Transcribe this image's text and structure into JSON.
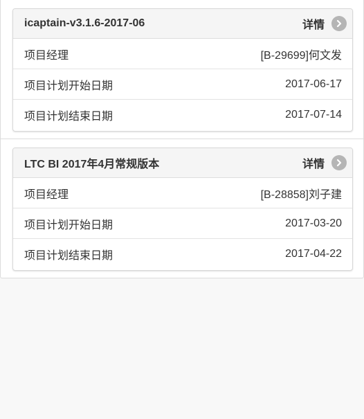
{
  "projects": [
    {
      "title": "icaptain-v3.1.6-2017-06",
      "detail_label": "详情",
      "rows": [
        {
          "label": "项目经理",
          "value": "[B-29699]何文发"
        },
        {
          "label": "项目计划开始日期",
          "value": "2017-06-17"
        },
        {
          "label": "项目计划结束日期",
          "value": "2017-07-14"
        }
      ]
    },
    {
      "title": "LTC BI 2017年4月常规版本",
      "detail_label": "详情",
      "rows": [
        {
          "label": "项目经理",
          "value": "[B-28858]刘子建"
        },
        {
          "label": "项目计划开始日期",
          "value": "2017-03-20"
        },
        {
          "label": "项目计划结束日期",
          "value": "2017-04-22"
        }
      ]
    }
  ],
  "icons": {
    "detail": "chevron-right-circle-icon"
  },
  "colors": {
    "background": "#f8f8f8",
    "card_header": "#f5f5f5",
    "chevron_circle": "#b5b5b5",
    "text": "#333333"
  }
}
